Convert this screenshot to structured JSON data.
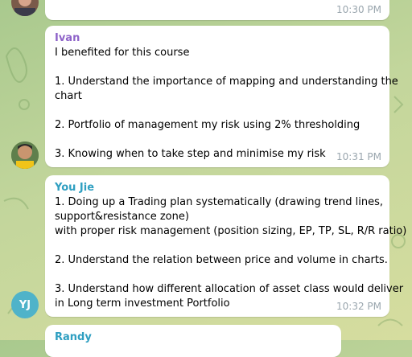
{
  "messages": [
    {
      "time": "10:30 PM"
    },
    {
      "sender": "Ivan",
      "sender_color": "#8e63c9",
      "lines": [
        "I benefited for this course",
        "",
        "1. Understand the importance of mapping and understanding the",
        "chart",
        "",
        "2. Portfolio of management my risk using 2% thresholding",
        "",
        "3. Knowing when to take step and minimise my risk"
      ],
      "time": "10:31 PM"
    },
    {
      "sender": "You Jie",
      "sender_color": "#2f9fc1",
      "avatar_initials": "YJ",
      "lines": [
        "1. Doing up a Trading plan systematically (drawing trend lines,",
        "support&resistance zone)",
        "with proper risk management (position sizing, EP, TP, SL, R/R ratio)",
        "",
        "2. Understand the relation between price and volume in charts.",
        "",
        "3. Understand how different allocation of asset class would deliver",
        "in Long term investment Portfolio"
      ],
      "time": "10:32 PM"
    },
    {
      "sender": "Randy",
      "sender_color": "#2f9fc1"
    }
  ]
}
